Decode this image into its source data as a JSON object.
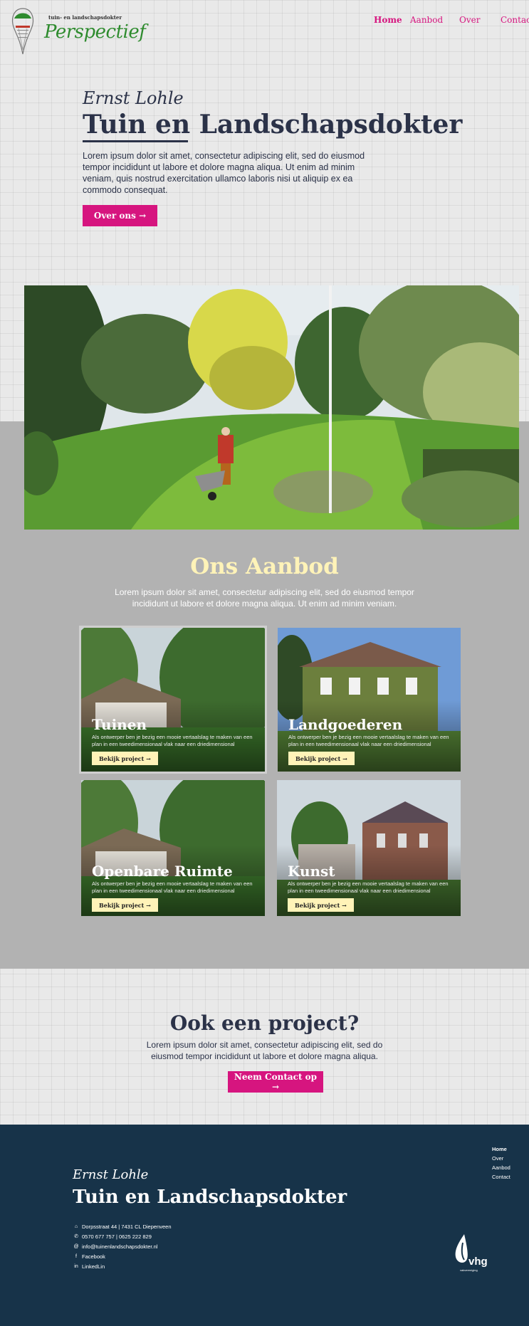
{
  "header": {
    "logo_subtitle": "tuin- en landschapsdokter",
    "logo_name": "Perspectief",
    "nav": [
      "Home",
      "Aanbod",
      "Over",
      "Contact"
    ]
  },
  "hero": {
    "script_name": "Ernst Lohle",
    "title": "Tuin en Landschapsdokter",
    "text": "Lorem ipsum dolor sit amet, consectetur adipiscing elit, sed do eiusmod tempor incididunt ut labore et dolore magna aliqua. Ut enim ad minim veniam, quis nostrud exercitation ullamco laboris nisi ut aliquip ex ea commodo consequat.",
    "button": "Over ons →"
  },
  "aanbod": {
    "title": "Ons Aanbod",
    "text": "Lorem ipsum dolor sit amet, consectetur adipiscing elit, sed do eiusmod tempor incididunt ut labore et dolore magna aliqua. Ut enim ad minim veniam.",
    "cards": [
      {
        "title": "Tuinen",
        "desc": "Als ontwerper ben je bezig een mooie vertaalslag te maken van een plan in een tweedimensionaal vlak naar een driedimensional",
        "button": "Bekijk project →"
      },
      {
        "title": "Landgoederen",
        "desc": "Als ontwerper ben je bezig een mooie vertaalslag te maken van een plan in een tweedimensionaal vlak naar een driedimensional",
        "button": "Bekijk project →"
      },
      {
        "title": "Openbare Ruimte",
        "desc": "Als ontwerper ben je bezig een mooie vertaalslag te maken van een plan in een tweedimensionaal vlak naar een driedimensional",
        "button": "Bekijk project →"
      },
      {
        "title": "Kunst",
        "desc": "Als ontwerper ben je bezig een mooie vertaalslag te maken van een plan in een tweedimensionaal vlak naar een driedimensional",
        "button": "Bekijk project →"
      }
    ]
  },
  "project": {
    "title": "Ook een project?",
    "text": "Lorem ipsum dolor sit amet, consectetur adipiscing elit, sed do eiusmod tempor incididunt ut labore et dolore magna aliqua.",
    "button": "Neem Contact op →"
  },
  "footer": {
    "script_name": "Ernst Lohle",
    "title": "Tuin en Landschapsdokter",
    "contact": [
      {
        "icon": "home-icon",
        "text": "Dorpsstraat 44 | 7431 CL Diepenveen"
      },
      {
        "icon": "phone-icon",
        "text": "0570 677 757 | 0625 222 829"
      },
      {
        "icon": "at-icon",
        "text": "info@tuinenlandschapsdokter.nl"
      },
      {
        "icon": "facebook-icon",
        "text": "Facebook"
      },
      {
        "icon": "linkedin-icon",
        "text": "LinkedLin"
      }
    ],
    "nav": [
      "Home",
      "Over",
      "Aanbod",
      "Contact"
    ],
    "badge_text": "vhg",
    "badge_subtext": "vakvereniging"
  },
  "colors": {
    "accent": "#d6157f",
    "navy": "#2b3248",
    "footer": "#173349",
    "cream": "#fff3b8",
    "grey_band": "#b2b2b2"
  }
}
